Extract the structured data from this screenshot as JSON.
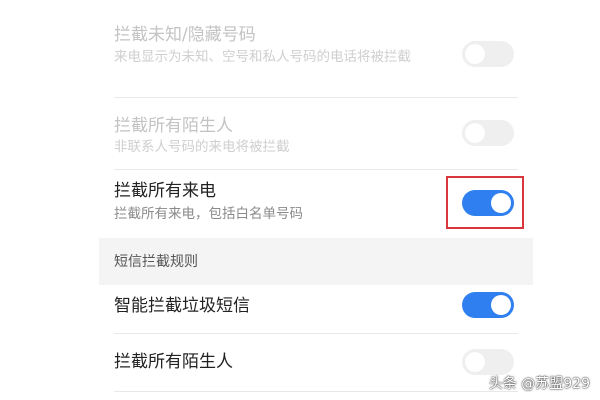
{
  "call_rules": [
    {
      "title": "拦截未知/隐藏号码",
      "description": "来电显示为未知、空号和私人号码的电话将被拦截",
      "enabled": false,
      "disabled": true
    },
    {
      "title": "拦截所有陌生人",
      "description": "非联系人号码的来电将被拦截",
      "enabled": false,
      "disabled": true
    },
    {
      "title": "拦截所有来电",
      "description": "拦截所有来电，包括白名单号码",
      "enabled": true,
      "disabled": false
    }
  ],
  "sms_section": {
    "header": "短信拦截规则",
    "rules": [
      {
        "title": "智能拦截垃圾短信",
        "enabled": true
      },
      {
        "title": "拦截所有陌生人",
        "enabled": false
      }
    ]
  },
  "watermark": "头条 @苏盟929",
  "colors": {
    "toggle_on": "#2f7ff0",
    "toggle_off": "#efefef",
    "highlight_box": "#d9363e"
  }
}
